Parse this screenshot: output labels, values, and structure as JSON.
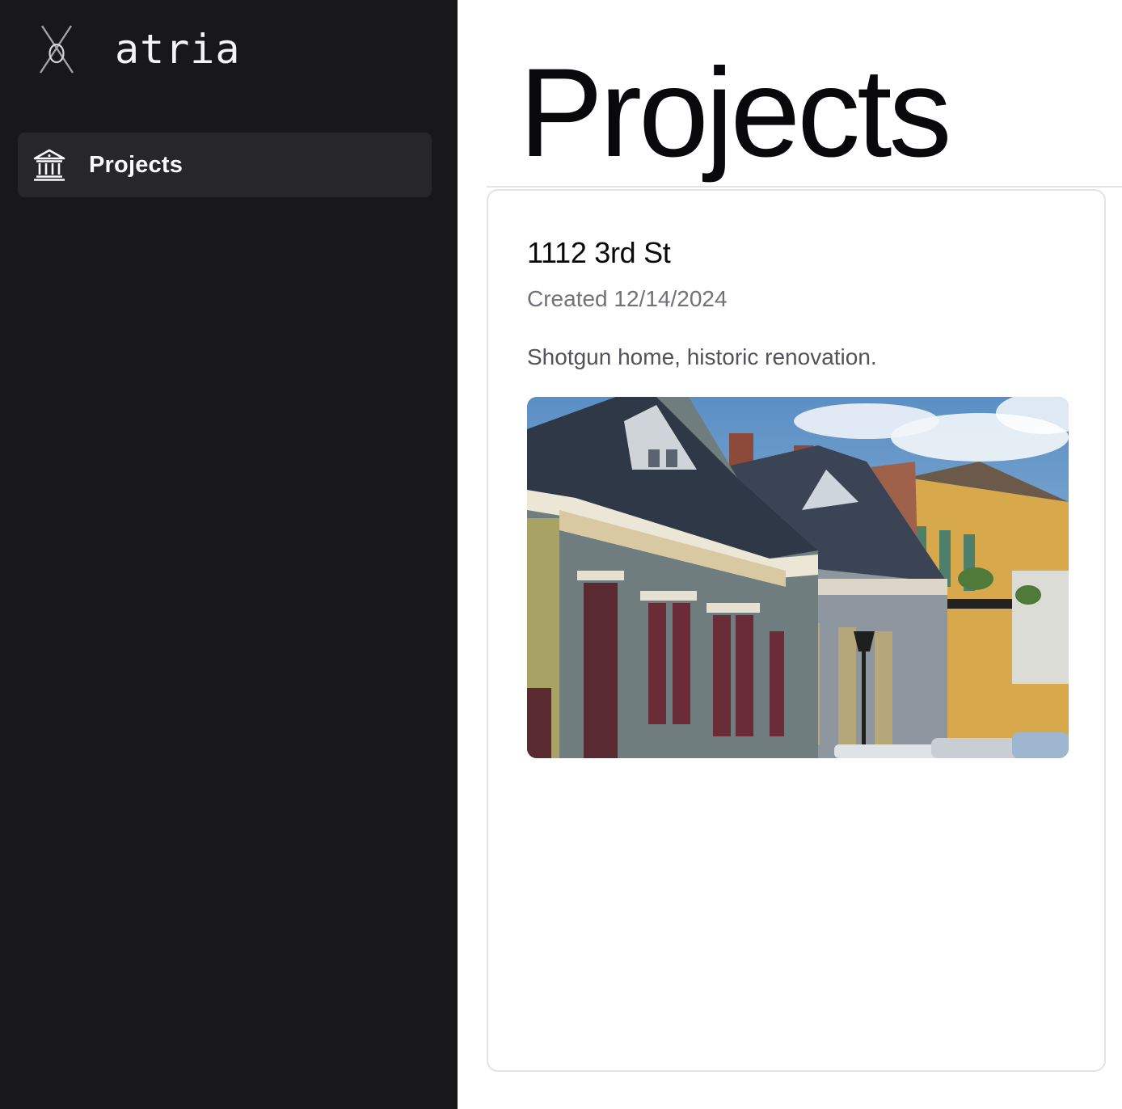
{
  "sidebar": {
    "brand": {
      "name": "atria",
      "logo_icon": "atria-logo-icon"
    },
    "items": [
      {
        "label": "Projects",
        "icon": "building-columns-icon",
        "active": true
      }
    ]
  },
  "main": {
    "title": "Projects",
    "projects": [
      {
        "name": "1112 3rd St",
        "created": "Created 12/14/2024",
        "description": "Shotgun home, historic renovation.",
        "image_icon": "house-photo"
      }
    ]
  },
  "colors": {
    "sidebar_bg": "#18181b",
    "nav_active_bg": "#27272a",
    "card_border": "#e4e4e7",
    "muted_text": "#71717a"
  }
}
